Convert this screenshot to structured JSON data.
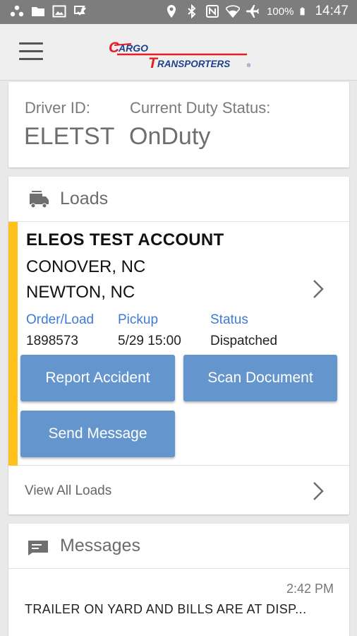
{
  "status_bar": {
    "battery": "100%",
    "time": "14:47",
    "left_icons": [
      "dots-icon",
      "folder-icon",
      "image-icon",
      "checkmark-icon"
    ],
    "right_icons": [
      "location-icon",
      "bluetooth-icon",
      "nfc-icon",
      "wifi-icon",
      "airplane-icon",
      "battery-icon"
    ]
  },
  "app_bar": {
    "menu_icon": "hamburger-menu-icon",
    "logo_line1": "CARGO",
    "logo_line2": "TRANSPORTERS",
    "logo_color": "#e31e24",
    "logo_line_color": "#1f3f8f"
  },
  "driver": {
    "id_label": "Driver ID:",
    "id_value": "ELETST",
    "status_label": "Current Duty Status:",
    "status_value": "OnDuty"
  },
  "loads": {
    "title": "Loads",
    "icon": "truck-icon",
    "item": {
      "account": "ELEOS TEST ACCOUNT",
      "origin": "CONOVER, NC",
      "destination": "NEWTON, NC",
      "fields": [
        {
          "label": "Order/Load",
          "value": "1898573"
        },
        {
          "label": "Pickup",
          "value": "5/29 15:00"
        },
        {
          "label": "Status",
          "value": "Dispatched"
        }
      ],
      "accent_color": "#ffc21a"
    },
    "buttons": {
      "report_accident": "Report Accident",
      "scan_document": "Scan Document",
      "send_message": "Send Message"
    },
    "view_all": "View All Loads"
  },
  "messages": {
    "title": "Messages",
    "icon": "message-icon",
    "items": [
      {
        "time": "2:42 PM",
        "text": "TRAILER ON YARD AND BILLS ARE AT DISP..."
      }
    ]
  },
  "colors": {
    "status_bar": "#7d7d7d",
    "app_bar": "#efefef",
    "button": "#6495cc",
    "field_label": "#3d7bd6",
    "background": "#e9e9e9"
  }
}
